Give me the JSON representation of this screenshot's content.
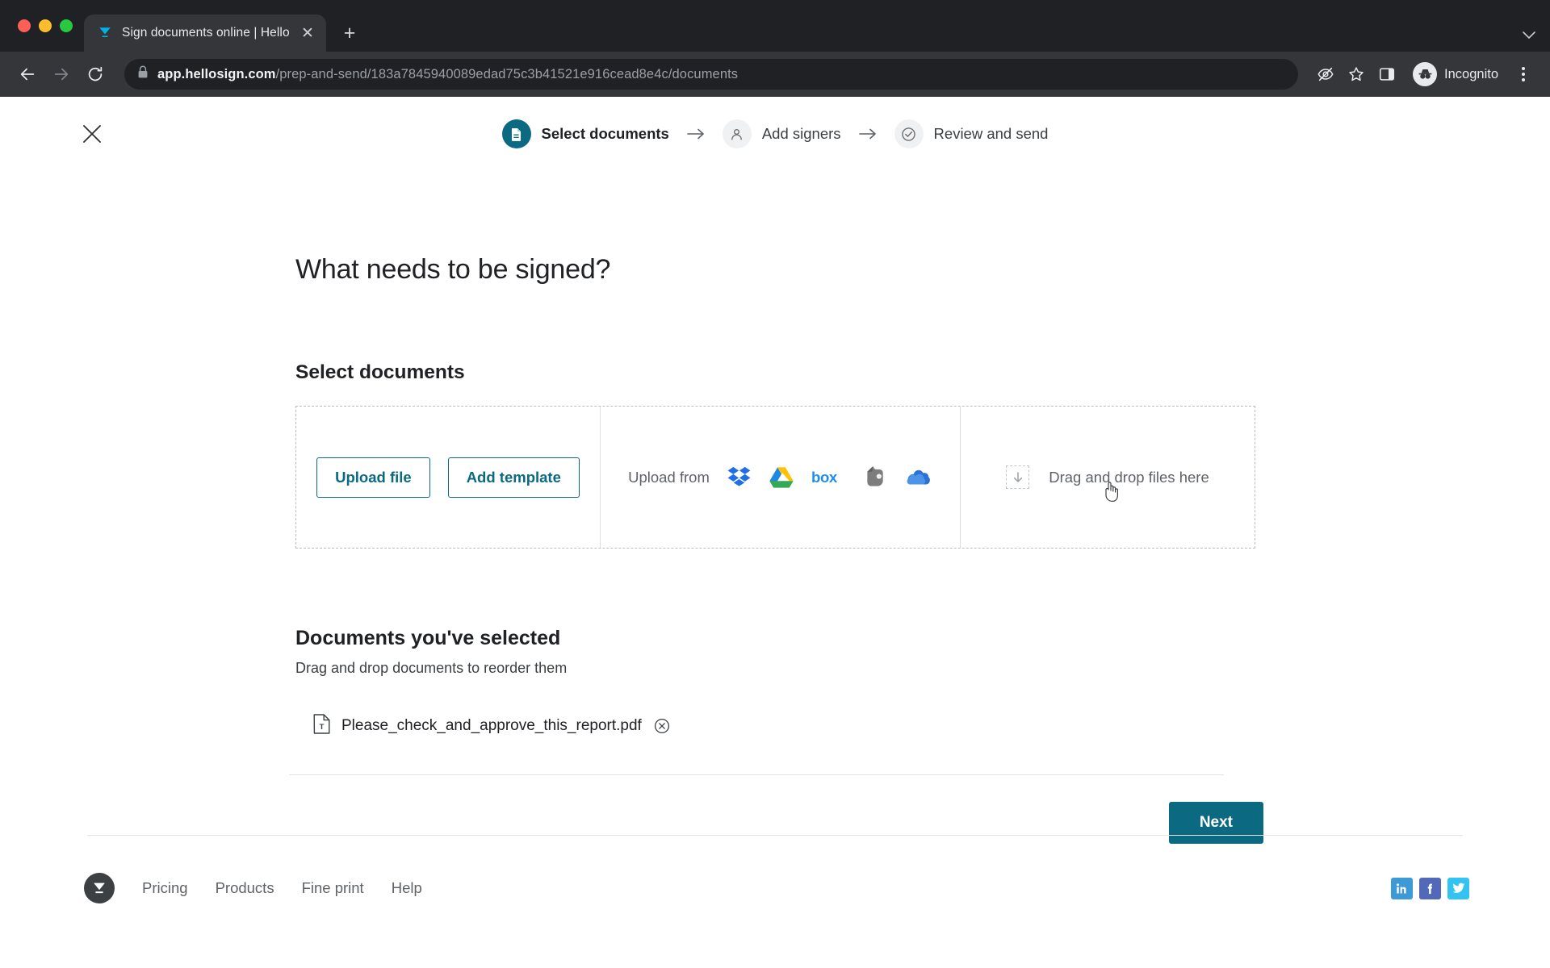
{
  "browser": {
    "tab": {
      "title": "Sign documents online | HelloS",
      "favicon_icon": "hellosign-favicon-icon",
      "close_icon": "close-icon"
    },
    "new_tab_icon": "new-tab-icon",
    "tabstrip_expand_icon": "chevron-down-icon",
    "back_icon": "back-arrow-icon",
    "forward_icon": "forward-arrow-icon",
    "reload_icon": "reload-icon",
    "lock_icon": "lock-icon",
    "url_host": "app.hellosign.com",
    "url_path": "/prep-and-send/183a7845940089edad75c3b41521e916cead8e4c/documents",
    "url_full": "app.hellosign.com/prep-and-send/183a7845940089edad75c3b41521e916cead8e4c/documents",
    "third_party_cookie_icon": "eye-slash-icon",
    "bookmark_icon": "star-icon",
    "side_panel_icon": "side-panel-icon",
    "incognito_label": "Incognito",
    "incognito_icon": "incognito-avatar-icon",
    "menu_icon": "kebab-menu-icon"
  },
  "app": {
    "close_icon": "close-icon",
    "stepper": [
      {
        "label": "Select documents",
        "icon": "document-icon",
        "state": "active"
      },
      {
        "label": "Add signers",
        "icon": "person-icon",
        "state": "idle"
      },
      {
        "label": "Review and send",
        "icon": "check-circle-icon",
        "state": "idle"
      }
    ],
    "stepper_arrow_icon": "arrow-right-icon",
    "heading": "What needs to be signed?",
    "select_documents": {
      "section_title": "Select documents",
      "upload_file_label": "Upload file",
      "add_template_label": "Add template",
      "upload_from_label": "Upload from",
      "cloud_services": [
        {
          "name": "Dropbox",
          "icon": "dropbox-icon",
          "color": "#1e6fe8"
        },
        {
          "name": "Google Drive",
          "icon": "google-drive-icon",
          "color": "#34a853"
        },
        {
          "name": "Box",
          "icon": "box-icon",
          "color": "#1f8ded"
        },
        {
          "name": "Evernote",
          "icon": "evernote-icon",
          "color": "#7d7d7d"
        },
        {
          "name": "OneDrive",
          "icon": "onedrive-icon",
          "color": "#2a72d4"
        }
      ],
      "drag_drop_label": "Drag and drop files here",
      "drag_drop_icon": "download-arrow-icon"
    },
    "documents_selected": {
      "section_title": "Documents you've selected",
      "subtitle": "Drag and drop documents to reorder them",
      "files": [
        {
          "name": "Please_check_and_approve_this_report.pdf",
          "file_icon": "pdf-file-icon",
          "remove_icon": "remove-circle-icon"
        }
      ]
    },
    "next_label": "Next",
    "accent_color": "#0b6a82"
  },
  "footer": {
    "logo_icon": "hellosign-logo-icon",
    "links": [
      {
        "label": "Pricing"
      },
      {
        "label": "Products"
      },
      {
        "label": "Fine print"
      },
      {
        "label": "Help"
      }
    ],
    "social": [
      {
        "name": "LinkedIn",
        "icon": "linkedin-icon",
        "color": "#3d9ad6"
      },
      {
        "name": "Facebook",
        "icon": "facebook-icon",
        "color": "#5169b8"
      },
      {
        "name": "Twitter",
        "icon": "twitter-icon",
        "color": "#32c3f3"
      }
    ]
  },
  "cursor": {
    "icon": "pointer-hand-cursor"
  }
}
